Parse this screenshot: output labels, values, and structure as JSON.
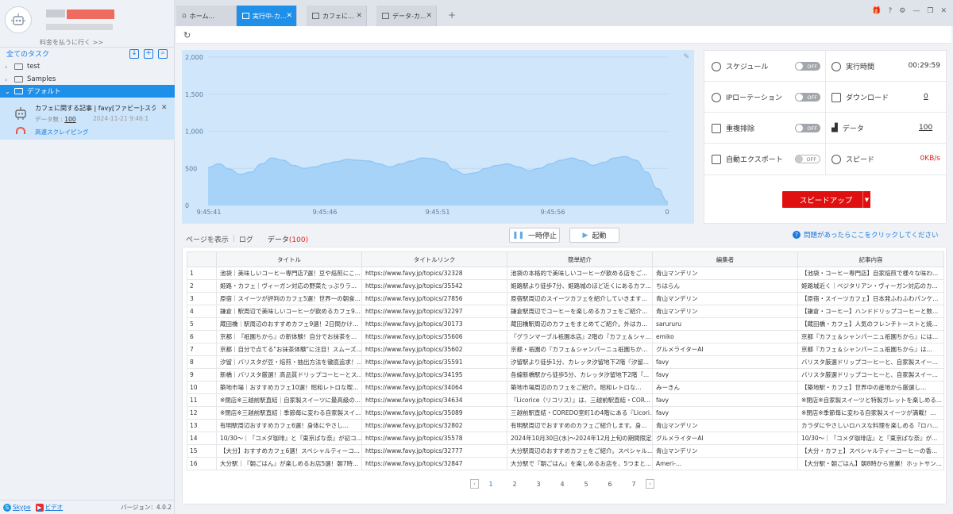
{
  "sidebar": {
    "upgrade_link": "料金を払うに行く >>",
    "all_tasks_label": "全てのタスク",
    "folders": [
      {
        "label": "test",
        "state": "collapsed"
      },
      {
        "label": "Samples",
        "state": "collapsed"
      },
      {
        "label": "デフォルト",
        "state": "expanded"
      }
    ],
    "task": {
      "name": "カフェに関する記事 | favy[ファビー]-スク...",
      "data_count_label": "データ数 : ",
      "data_count": "100",
      "date": "2024-11-21 9:46:1",
      "mode": "高速スクレイピング"
    },
    "footer": {
      "skype": "Skype",
      "video": "ビデオ",
      "version": "バージョン：4.0.2"
    }
  },
  "tabs": [
    {
      "label": "ホーム...",
      "active": false
    },
    {
      "label": "実行中-カ...",
      "active": true
    },
    {
      "label": "カフェに...",
      "active": false
    },
    {
      "label": "データ-カ...",
      "active": false
    }
  ],
  "chart_data": {
    "type": "area",
    "ylim": [
      0,
      2000
    ],
    "y_ticks": [
      "2,000",
      "1,500",
      "1,000",
      "500",
      "0"
    ],
    "x_ticks": [
      "9:45:41",
      "9:45:46",
      "9:45:51",
      "9:45:56",
      "0"
    ],
    "values": [
      510,
      560,
      490,
      420,
      450,
      560,
      640,
      610,
      540,
      500,
      520,
      560,
      590,
      620,
      610,
      600,
      560,
      520,
      560,
      600,
      640,
      630,
      590,
      480,
      420,
      440,
      500,
      540,
      560,
      520,
      470,
      500,
      560,
      610,
      640,
      600,
      540,
      580,
      640,
      660,
      610,
      450,
      230,
      50
    ],
    "colors": {
      "fill": "#a7d3f8",
      "stroke": "#8fc4f3",
      "background": "#cfe6fb"
    }
  },
  "stats": {
    "schedule": {
      "label": "スケジュール",
      "toggle": "OFF"
    },
    "run_time": {
      "label": "実行時間",
      "value": "00:29:59"
    },
    "ip_rotation": {
      "label": "IPローテーション",
      "toggle": "OFF"
    },
    "download": {
      "label": "ダウンロード",
      "value": "0"
    },
    "dedupe": {
      "label": "重複排除",
      "toggle": "OFF"
    },
    "data": {
      "label": "データ",
      "value": "100"
    },
    "auto_export": {
      "label": "自動エクスポート",
      "toggle": "OFF"
    },
    "speed": {
      "label": "スピード",
      "value": "0KB/s"
    },
    "speed_up_button": "スピードアップ",
    "speed_up_arrow": "▼"
  },
  "lower": {
    "view_page": "ページを表示",
    "log": "ログ",
    "data_tab": "データ",
    "data_count": "(100)",
    "pause": "一時停止",
    "start": "起動",
    "help": "問題があったらここをクリックしてください"
  },
  "table": {
    "columns": [
      "",
      "タイトル",
      "タイトルリンク",
      "簡単紹介",
      "編集者",
      "記事内容"
    ],
    "rows": [
      [
        "1",
        "池袋｜美味しいコーヒー専門店7選！豆や焙煎にこ...",
        "https://www.favy.jp/topics/32328",
        "池袋の本格的で美味しいコーヒーが飲める店をご...",
        "青山マンデリン",
        "【池袋・コーヒー専門店】自家焙煎で様々な味わ..."
      ],
      [
        "2",
        "姫路・カフェ｜ヴィーガン対応の野菜たっぷりラ...",
        "https://www.favy.jp/topics/35542",
        "姫路駅より徒歩7分、姫路城のほど近くにあるカフ...",
        "ちはらん",
        "姫路城近く｜ベジタリアン・ヴィーガン対応のカ..."
      ],
      [
        "3",
        "原宿｜スイーツが評判のカフェ5選！世界一の朝食...",
        "https://www.favy.jp/topics/27856",
        "原宿駅周辺のスイーツカフェを紹介していきます...",
        "青山マンデリン",
        "【原宿・スイーツカフェ】日本発ふわふわパンケ..."
      ],
      [
        "4",
        "鎌倉｜駅周辺で美味しいコーヒーが飲めるカフェ9...",
        "https://www.favy.jp/topics/32297",
        "鎌倉駅周辺でコーヒーを楽しめるカフェをご紹介...",
        "青山マンデリン",
        "【鎌倉・コーヒー】ハンドドリップコーヒーと数..."
      ],
      [
        "5",
        "蔵田橋｜駅周辺のおすすめカフェ9選！2日間かけ...",
        "https://www.favy.jp/topics/30173",
        "蔵田橋駅周辺のカフェをまとめてご紹介。外はカ...",
        "sarururu",
        "【蔵田橋・カフェ】人気のフレンチトーストと焼..."
      ],
      [
        "6",
        "京都｜『祇園ちから』の新体験！自分でお抹茶を...",
        "https://www.favy.jp/topics/35606",
        "『グランマーブル祇園本店』2階の『カフェ＆シャ...",
        "emiko",
        "京都『カフェ＆シャンパーニュ祇園ちから』には..."
      ],
      [
        "7",
        "京都｜自分で点てる\"お抹茶体験\"に注目！スムーズ...",
        "https://www.favy.jp/topics/35602",
        "京都・祇園の『カフェ＆シャンパーニュ祇園ちか...",
        "グルメライターAI",
        "京都『カフェ＆シャンパーニュ祇園ちから』は..."
      ],
      [
        "8",
        "汐留｜バリスタが豆・焙煎・抽出方法を徹底追求！...",
        "https://www.favy.jp/topics/35591",
        "汐留駅より徒歩1分、カレッタ汐留地下2階『汐留...",
        "favy",
        "バリスタ厳選ドリップコーヒーと、自家製スイー..."
      ],
      [
        "9",
        "新橋｜バリスタ厳選！高品質ドリップコーヒーとス...",
        "https://www.favy.jp/topics/34195",
        "各線新橋駅から徒歩5分、カレッタ汐留地下2階『...",
        "favy",
        "バリスタ厳選ドリップコーヒーと、自家製スイー..."
      ],
      [
        "10",
        "築地市場｜おすすめカフェ10選！昭和レトロな喫...",
        "https://www.favy.jp/topics/34064",
        "築地市場周辺のカフェをご紹介。昭和レトロな...",
        "みーきん",
        "【築地駅・カフェ】世界中の産地から厳選し..."
      ],
      [
        "11",
        "※閉店※三越前駅直結｜自家製スイーツに最高級の...",
        "https://www.favy.jp/topics/34634",
        "『Licorice（リコリス）』は、三越前駅直結・COR...",
        "favy",
        "※閉店※自家製スイーツと特製ガレットを楽しめる..."
      ],
      [
        "12",
        "※閉店※三越前駅直結｜季節毎に変わる自家製スイ...",
        "https://www.favy.jp/topics/35089",
        "三越前駅直結・COREDO室町1の4階にある『Licori...",
        "favy",
        "※閉店※季節毎に変わる自家製スイーツが満載！..."
      ],
      [
        "13",
        "有明駅周辺おすすめカフェ6選！身体にやさし...",
        "https://www.favy.jp/topics/32802",
        "有明駅周辺でおすすめのカフェご紹介します。身...",
        "青山マンデリン",
        "カラダにやさしいロハスな料理を楽しめる『ロハ..."
      ],
      [
        "14",
        "10/30〜｜『コメダ珈琲』と『東京ばな奈』が初コ...",
        "https://www.favy.jp/topics/35578",
        "2024年10月30日(水)〜2024年12月上旬の期間限定...",
        "グルメライターAI",
        "10/30〜｜『コメダ珈琲店』と『東京ばな奈』が..."
      ],
      [
        "15",
        "【大分】おすすめカフェ6選！スペシャルティーコ...",
        "https://www.favy.jp/topics/32777",
        "大分駅周辺のおすすめカフェをご紹介。スペシャル...",
        "青山マンデリン",
        "【大分・カフェ】スペシャルティーコーヒーの香..."
      ],
      [
        "16",
        "大分駅｜『朝ごはん』が楽しめるお店5選！朝7時...",
        "https://www.favy.jp/topics/32847",
        "大分駅で『朝ごはん』を楽しめるお店を、5つまと...",
        "Ameri-...",
        "【大分駅・朝ごはん】朝8時から営業！ホットサン..."
      ]
    ]
  },
  "pager": {
    "pages": [
      "1",
      "2",
      "3",
      "4",
      "5",
      "6",
      "7"
    ],
    "current": "1"
  }
}
